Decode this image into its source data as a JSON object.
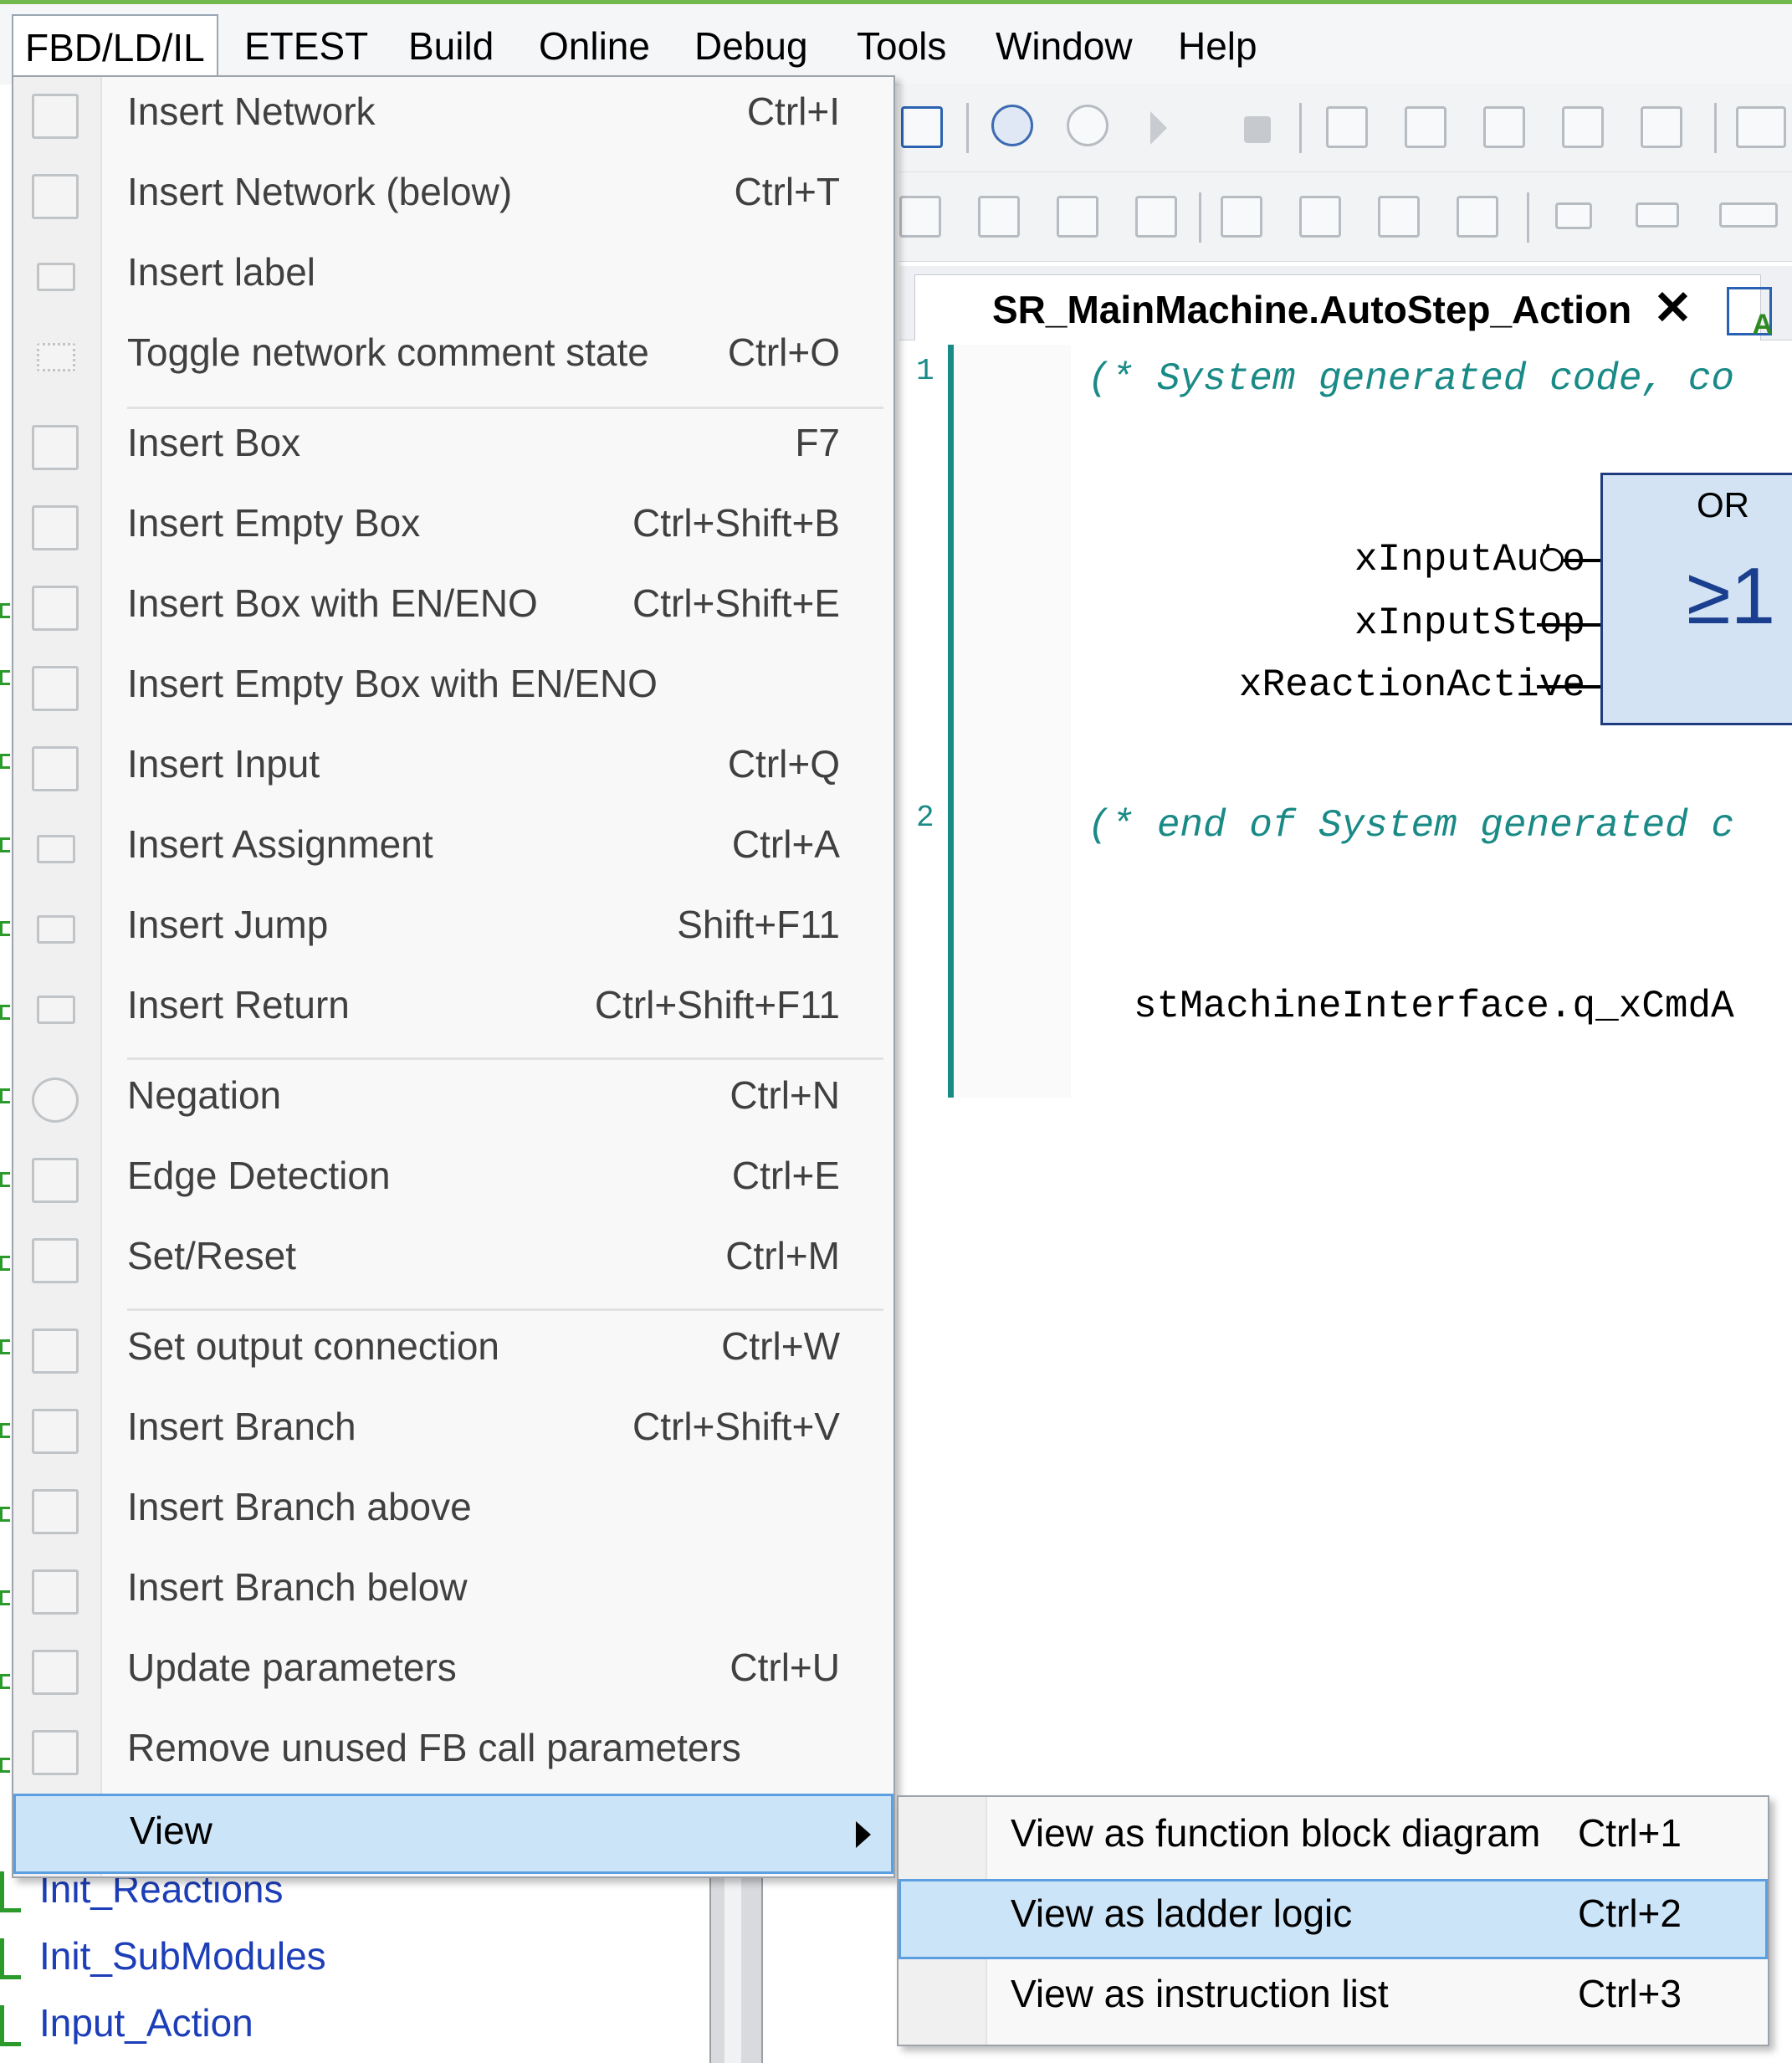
{
  "menubar": {
    "items": [
      "FBD/LD/IL",
      "ETEST",
      "Build",
      "Online",
      "Debug",
      "Tools",
      "Window",
      "Help"
    ]
  },
  "editor": {
    "tab_title": "SR_MainMachine.AutoStep_Action",
    "network1_number": "1",
    "network1_comment": "(* System generated code, co",
    "network2_number": "2",
    "network2_comment": "(* end of System generated c",
    "box_name": "OR",
    "box_symbol": "≥1",
    "inputs": [
      "xInputAuto",
      "xInputStop",
      "xReactionActive"
    ],
    "output_line": "stMachineInterface.q_xCmdA"
  },
  "tree": {
    "items": [
      "Init_Reactions",
      "Init_SubModules",
      "Input_Action"
    ]
  },
  "menu": {
    "items": [
      {
        "label": "Insert Network",
        "shortcut": "Ctrl+I"
      },
      {
        "label": "Insert Network (below)",
        "shortcut": "Ctrl+T"
      },
      {
        "label": "Insert label",
        "shortcut": ""
      },
      {
        "label": "Toggle network comment state",
        "shortcut": "Ctrl+O"
      },
      {
        "label": "Insert Box",
        "shortcut": "F7"
      },
      {
        "label": "Insert Empty Box",
        "shortcut": "Ctrl+Shift+B"
      },
      {
        "label": "Insert Box with EN/ENO",
        "shortcut": "Ctrl+Shift+E"
      },
      {
        "label": "Insert Empty Box with EN/ENO",
        "shortcut": ""
      },
      {
        "label": "Insert Input",
        "shortcut": "Ctrl+Q"
      },
      {
        "label": "Insert Assignment",
        "shortcut": "Ctrl+A"
      },
      {
        "label": "Insert Jump",
        "shortcut": "Shift+F11"
      },
      {
        "label": "Insert Return",
        "shortcut": "Ctrl+Shift+F11"
      },
      {
        "label": "Negation",
        "shortcut": "Ctrl+N"
      },
      {
        "label": "Edge Detection",
        "shortcut": "Ctrl+E"
      },
      {
        "label": "Set/Reset",
        "shortcut": "Ctrl+M"
      },
      {
        "label": "Set output connection",
        "shortcut": "Ctrl+W"
      },
      {
        "label": "Insert Branch",
        "shortcut": "Ctrl+Shift+V"
      },
      {
        "label": "Insert Branch above",
        "shortcut": ""
      },
      {
        "label": "Insert Branch below",
        "shortcut": ""
      },
      {
        "label": "Update parameters",
        "shortcut": "Ctrl+U"
      },
      {
        "label": "Remove unused FB call parameters",
        "shortcut": ""
      },
      {
        "label": "View",
        "shortcut": ""
      }
    ]
  },
  "submenu": {
    "items": [
      {
        "label": "View as function block diagram",
        "shortcut": "Ctrl+1"
      },
      {
        "label": "View as ladder logic",
        "shortcut": "Ctrl+2"
      },
      {
        "label": "View as instruction list",
        "shortcut": "Ctrl+3"
      }
    ]
  },
  "colors": {
    "highlight": "#cce4f8",
    "highlight_border": "#5c9fe0",
    "comment": "#1a8a87",
    "box_fill": "#d3e3f4",
    "tree_link": "#1c3eb8"
  }
}
